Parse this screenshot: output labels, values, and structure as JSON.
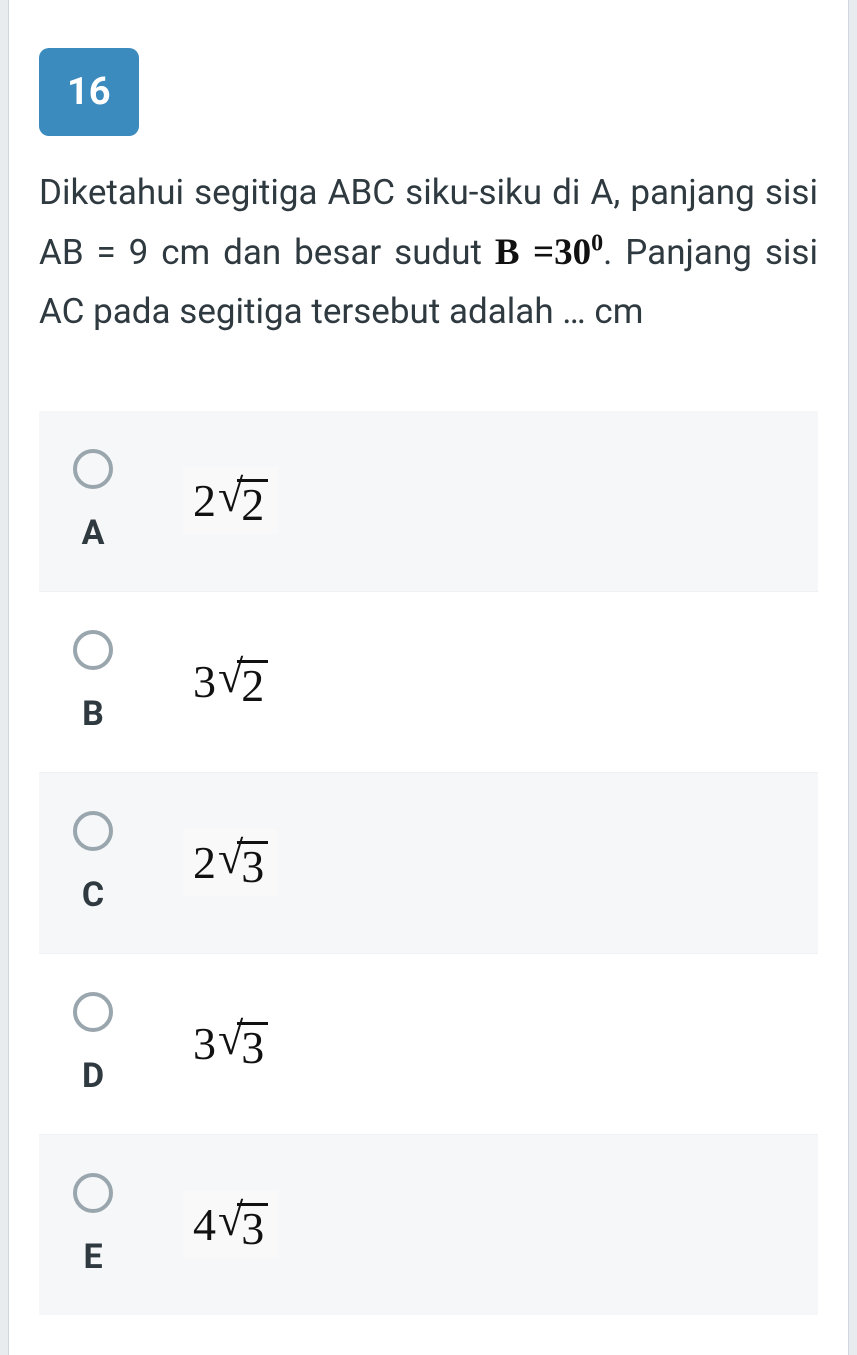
{
  "question": {
    "number": "16",
    "text_part1": "Diketahui segitiga ABC siku-siku di A, panjang sisi AB = 9 cm dan besar sudut ",
    "math_b": "B =30",
    "math_b_sup": "0",
    "text_part2": ". Panjang sisi AC pada segitiga tersebut adalah … cm"
  },
  "options": [
    {
      "letter": "A",
      "coef": "2",
      "radicand": "2",
      "shaded": true,
      "boxed": true
    },
    {
      "letter": "B",
      "coef": "3",
      "radicand": "2",
      "shaded": false,
      "boxed": false
    },
    {
      "letter": "C",
      "coef": "2",
      "radicand": "3",
      "shaded": true,
      "boxed": true
    },
    {
      "letter": "D",
      "coef": "3",
      "radicand": "3",
      "shaded": false,
      "boxed": false
    },
    {
      "letter": "E",
      "coef": "4",
      "radicand": "3",
      "shaded": true,
      "boxed": true
    }
  ]
}
